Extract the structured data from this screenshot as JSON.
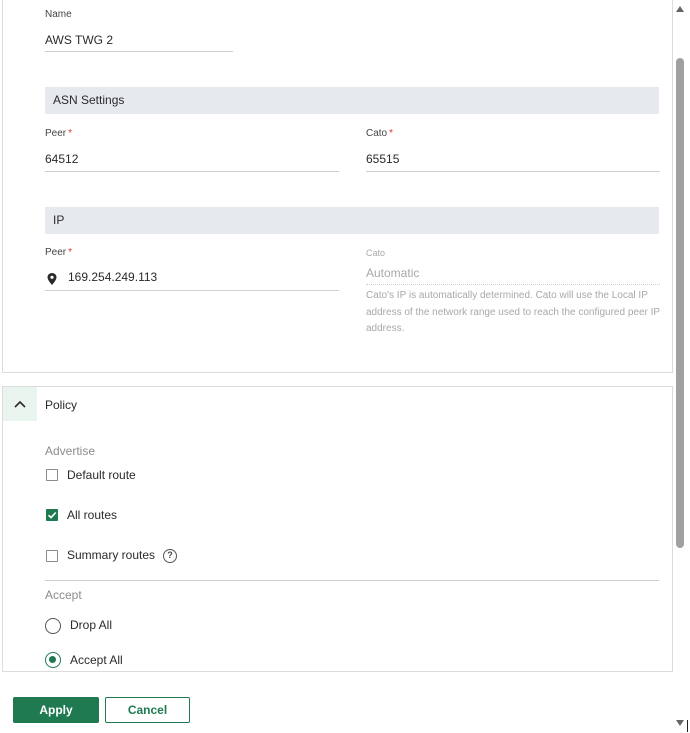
{
  "general": {
    "name_label": "Name",
    "name_value": "AWS TWG 2"
  },
  "asn": {
    "title": "ASN Settings",
    "peer_label": "Peer",
    "peer_value": "64512",
    "cato_label": "Cato",
    "cato_value": "65515",
    "required_mark": "*"
  },
  "ip": {
    "title": "IP",
    "peer_label": "Peer",
    "peer_value": "169.254.249.113",
    "cato_label": "Cato",
    "cato_value": "Automatic",
    "cato_help": "Cato's IP is automatically determined. Cato will use the Local IP address of the network range used to reach the configured peer IP address.",
    "required_mark": "*"
  },
  "policy": {
    "title": "Policy",
    "advertise_label": "Advertise",
    "advertise_options": [
      {
        "label": "Default route",
        "checked": false
      },
      {
        "label": "All routes",
        "checked": true
      },
      {
        "label": "Summary routes",
        "checked": false
      }
    ],
    "accept_label": "Accept",
    "accept_options": [
      {
        "label": "Drop All",
        "selected": false
      },
      {
        "label": "Accept All",
        "selected": true
      }
    ],
    "help_glyph": "?"
  },
  "footer": {
    "apply_label": "Apply",
    "cancel_label": "Cancel"
  },
  "colors": {
    "accent": "#1f7a52",
    "required": "#e0342c",
    "section_bg": "#e6e9ee"
  }
}
